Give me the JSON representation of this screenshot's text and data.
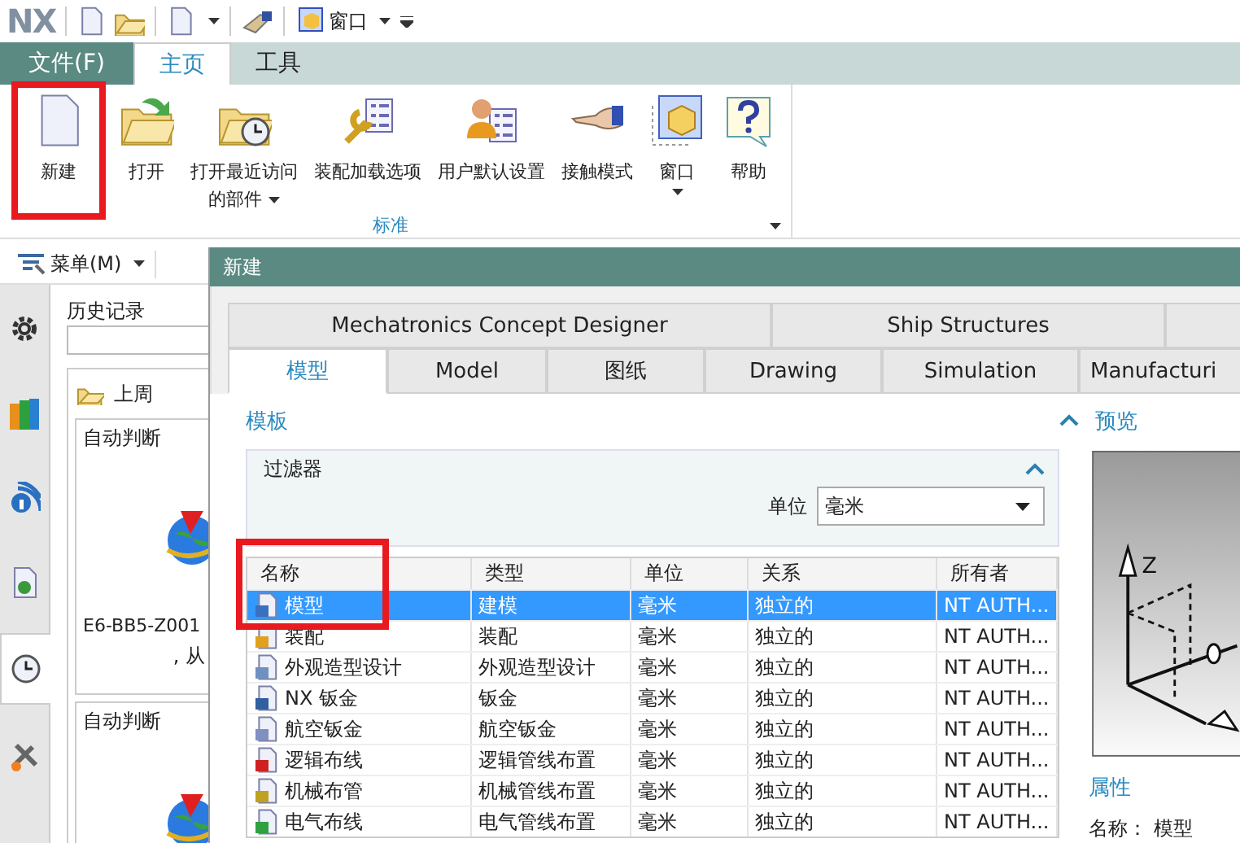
{
  "quick_access": {
    "logo": "NX",
    "window_menu": "窗口"
  },
  "ribbon_tabs": [
    {
      "label": "文件(F)",
      "selected": false,
      "kind": "file"
    },
    {
      "label": "主页",
      "selected": true,
      "kind": "tab"
    },
    {
      "label": "工具",
      "selected": false,
      "kind": "tab"
    }
  ],
  "ribbon_buttons": [
    {
      "label": "新建",
      "has_menu": false
    },
    {
      "label": "打开",
      "has_menu": false
    },
    {
      "label": "打开最近访问的部件",
      "has_menu": true
    },
    {
      "label": "装配加载选项",
      "has_menu": false
    },
    {
      "label": "用户默认设置",
      "has_menu": false
    },
    {
      "label": "接触模式",
      "has_menu": false
    },
    {
      "label": "窗口",
      "has_menu": true
    },
    {
      "label": "帮助",
      "has_menu": false
    }
  ],
  "ribbon_group": "标准",
  "menu_button": "菜单(M)",
  "resource_bar": [
    {
      "selected": false
    },
    {
      "selected": false
    },
    {
      "selected": false
    },
    {
      "selected": false
    },
    {
      "selected": true
    },
    {
      "selected": false
    }
  ],
  "history": {
    "title": "历史记录",
    "group": "上周",
    "cards": [
      {
        "label": "自动判断",
        "file": "E6-BB5-Z001",
        "note": ", 从"
      },
      {
        "label": "自动判断"
      }
    ]
  },
  "dialog": {
    "title": "新建",
    "tabs_row_1": [
      {
        "label": "Mechatronics Concept Designer"
      },
      {
        "label": "Ship Structures"
      }
    ],
    "tabs_row_2": [
      {
        "label": "模型",
        "selected": true
      },
      {
        "label": "Model",
        "selected": false
      },
      {
        "label": "图纸",
        "selected": false
      },
      {
        "label": "Drawing",
        "selected": false
      },
      {
        "label": "Simulation",
        "selected": false
      },
      {
        "label": "Manufacturi",
        "selected": false
      }
    ],
    "templates": {
      "title": "模板",
      "filter": {
        "title": "过滤器",
        "unit_label": "单位",
        "unit_value": "毫米"
      },
      "table": {
        "columns": [
          "名称",
          "类型",
          "单位",
          "关系",
          "所有者"
        ],
        "rows": [
          {
            "cells": [
              "模型",
              "建模",
              "毫米",
              "独立的",
              "NT AUTH..."
            ],
            "selected": true
          },
          {
            "cells": [
              "装配",
              "装配",
              "毫米",
              "独立的",
              "NT AUTH..."
            ],
            "selected": false
          },
          {
            "cells": [
              "外观造型设计",
              "外观造型设计",
              "毫米",
              "独立的",
              "NT AUTH..."
            ],
            "selected": false
          },
          {
            "cells": [
              "NX 钣金",
              "钣金",
              "毫米",
              "独立的",
              "NT AUTH..."
            ],
            "selected": false
          },
          {
            "cells": [
              "航空钣金",
              "航空钣金",
              "毫米",
              "独立的",
              "NT AUTH..."
            ],
            "selected": false
          },
          {
            "cells": [
              "逻辑布线",
              "逻辑管线布置",
              "毫米",
              "独立的",
              "NT AUTH..."
            ],
            "selected": false
          },
          {
            "cells": [
              "机械布管",
              "机械管线布置",
              "毫米",
              "独立的",
              "NT AUTH..."
            ],
            "selected": false
          },
          {
            "cells": [
              "电气布线",
              "电气管线布置",
              "毫米",
              "独立的",
              "NT AUTH..."
            ],
            "selected": false
          }
        ]
      }
    },
    "preview": {
      "title": "预览",
      "axis_label": "Z"
    },
    "properties": {
      "title": "属性",
      "name_label": "名称：",
      "name_value": "模型"
    }
  }
}
